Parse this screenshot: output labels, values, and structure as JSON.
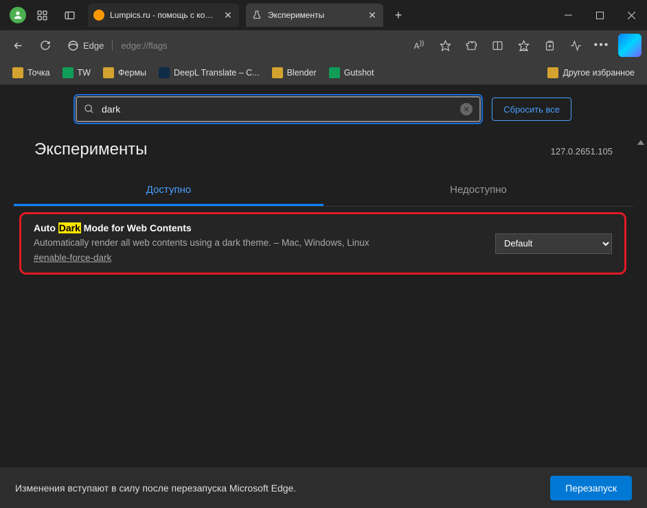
{
  "titlebar": {
    "tab1_title": "Lumpics.ru - помощь с компью…",
    "tab2_title": "Эксперименты"
  },
  "toolbar": {
    "edge_label": "Edge",
    "url": "edge://flags"
  },
  "bookmarks": {
    "items": [
      "Точка",
      "TW",
      "Фермы",
      "DeepL Translate – С...",
      "Blender",
      "Gutshot"
    ],
    "other": "Другое избранное"
  },
  "page": {
    "search_value": "dark",
    "reset_label": "Сбросить все",
    "title": "Эксперименты",
    "version": "127.0.2651.105",
    "tab_available": "Доступно",
    "tab_unavailable": "Недоступно",
    "flag": {
      "title_pre": "Auto ",
      "title_mark": "Dark",
      "title_post": " Mode for Web Contents",
      "desc": "Automatically render all web contents using a dark theme. – Mac, Windows, Linux",
      "anchor": "#enable-force-dark",
      "select_value": "Default"
    }
  },
  "footer": {
    "text": "Изменения вступают в силу после перезапуска Microsoft Edge.",
    "restart": "Перезапуск"
  }
}
